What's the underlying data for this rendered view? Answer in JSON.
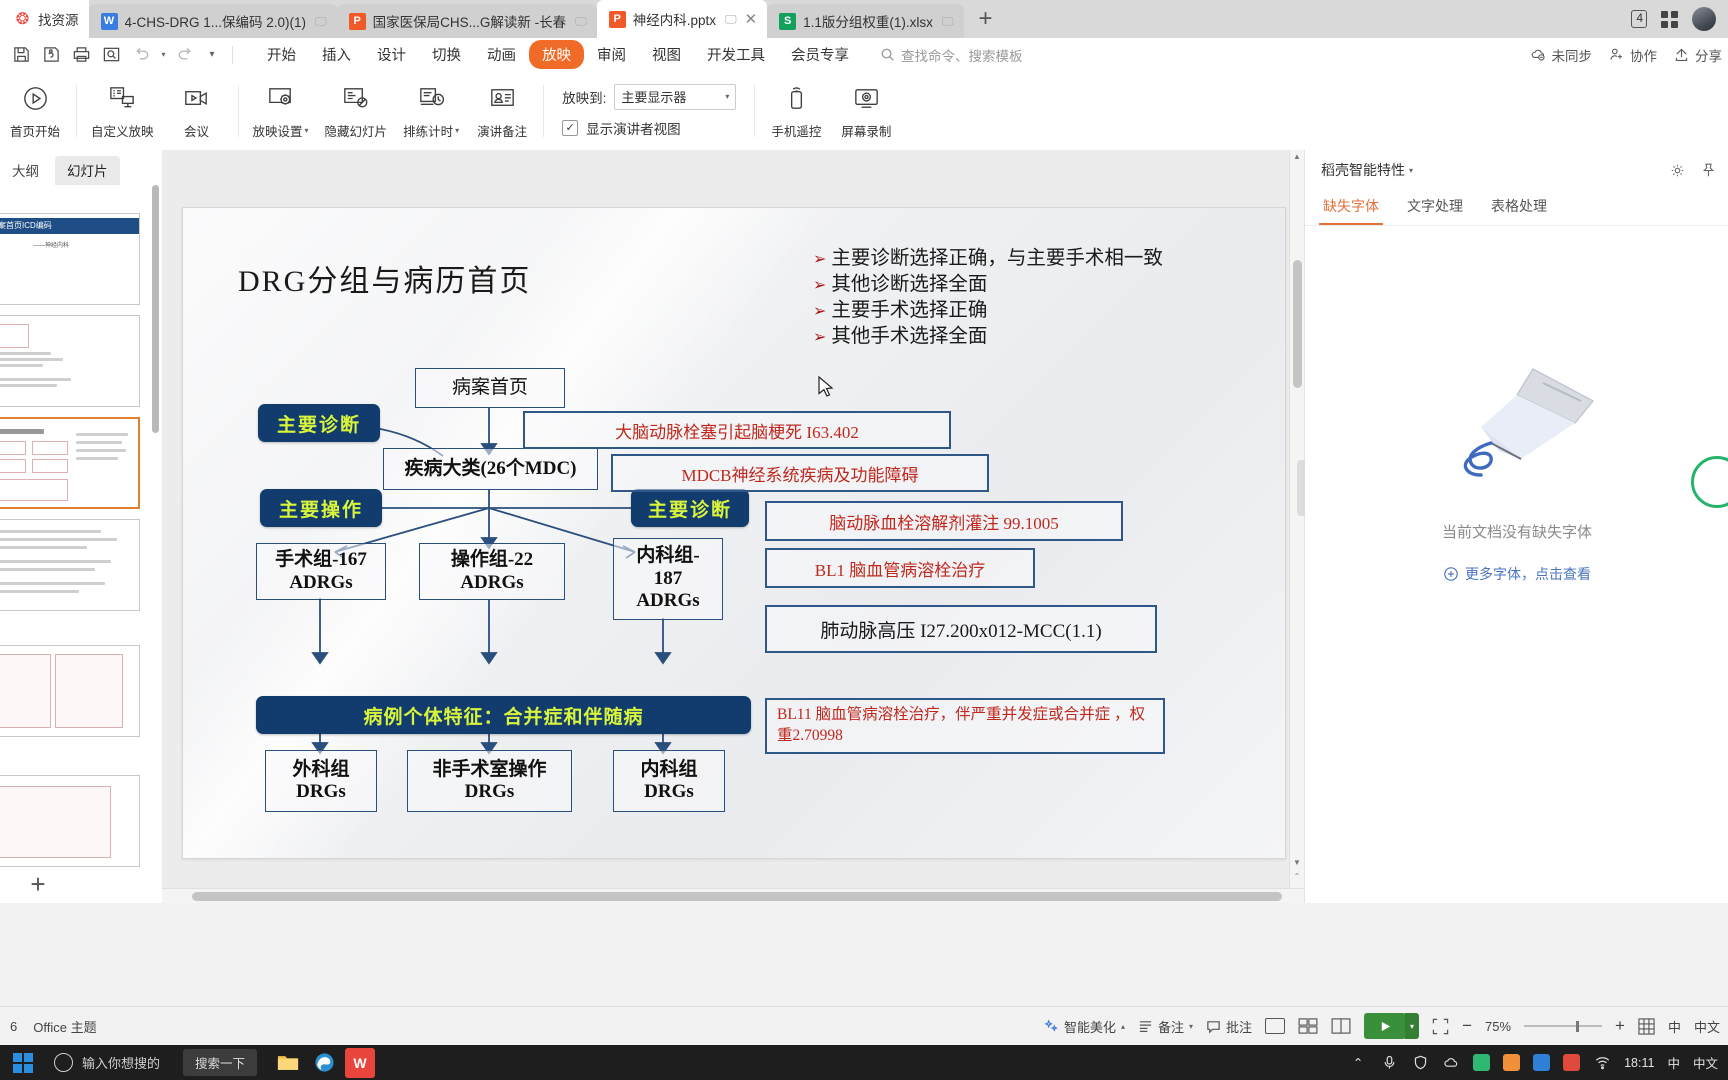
{
  "tabbar": {
    "tabs": [
      {
        "label": "找资源",
        "icon": "wps-resource-icon",
        "kind": "res",
        "monitor": false,
        "closable": false,
        "active": true
      },
      {
        "label": "4-CHS-DRG 1...保编码 2.0)(1)",
        "icon": "writer-doc-icon",
        "kind": "w",
        "monitor": true,
        "closable": false,
        "active": false
      },
      {
        "label": "国家医保局CHS...G解读新 -长春",
        "icon": "presentation-icon",
        "kind": "p",
        "monitor": true,
        "closable": false,
        "active": false
      },
      {
        "label": "神经内科.pptx",
        "icon": "presentation-icon",
        "kind": "p",
        "monitor": true,
        "closable": true,
        "active": true
      },
      {
        "label": "1.1版分组权重(1).xlsx",
        "icon": "spreadsheet-icon",
        "kind": "s",
        "monitor": true,
        "closable": false,
        "active": false
      }
    ],
    "new_tab_label": "+",
    "window_count_badge": "4",
    "app_grid_label": "",
    "avatar_label": ""
  },
  "menubar": {
    "quick_access": [
      "save-icon",
      "save-as-icon",
      "print-icon",
      "print-preview-icon",
      "undo-icon",
      "redo-icon",
      "customize-qat-icon"
    ],
    "menus": [
      {
        "label": "开始",
        "active": false
      },
      {
        "label": "插入",
        "active": false
      },
      {
        "label": "设计",
        "active": false
      },
      {
        "label": "切换",
        "active": false
      },
      {
        "label": "动画",
        "active": false
      },
      {
        "label": "放映",
        "active": true
      },
      {
        "label": "审阅",
        "active": false
      },
      {
        "label": "视图",
        "active": false
      },
      {
        "label": "开发工具",
        "active": false
      },
      {
        "label": "会员专享",
        "active": false
      }
    ],
    "search_placeholder": "查找命令、搜索模板",
    "right_items": [
      {
        "label": "未同步",
        "icon": "cloud-sync-icon"
      },
      {
        "label": "协作",
        "icon": "collaborate-icon"
      },
      {
        "label": "分享",
        "icon": "share-icon"
      }
    ]
  },
  "ribbon": {
    "items": [
      {
        "label": "首页开始",
        "icon": "play-circle-icon",
        "caret": false
      },
      {
        "label": "自定义放映",
        "icon": "custom-show-icon",
        "caret": false
      },
      {
        "label": "会议",
        "icon": "meeting-icon",
        "caret": false
      },
      {
        "label": "放映设置",
        "icon": "show-settings-icon",
        "caret": true
      },
      {
        "label": "隐藏幻灯片",
        "icon": "hide-slide-icon",
        "caret": false
      },
      {
        "label": "排练计时",
        "icon": "rehearse-timing-icon",
        "caret": true
      },
      {
        "label": "演讲备注",
        "icon": "speaker-notes-icon",
        "caret": false
      }
    ],
    "display_field_label": "放映到:",
    "display_value": "主要显示器",
    "presenter_view_label": "显示演讲者视图",
    "presenter_view_checked": true,
    "right_items": [
      {
        "label": "手机遥控",
        "icon": "phone-remote-icon"
      },
      {
        "label": "屏幕录制",
        "icon": "screen-record-icon"
      }
    ]
  },
  "view_tabs": [
    {
      "label": "大纲",
      "active": false
    },
    {
      "label": "幻灯片",
      "active": true
    }
  ],
  "slide_panel": {
    "add_slide_label": "+",
    "thumbnails": [
      {
        "index": 1,
        "selected": false,
        "title": "病案首页ICD编码",
        "subtitle": "——神经内科"
      },
      {
        "index": 2,
        "selected": false,
        "title": "",
        "subtitle": ""
      },
      {
        "index": 3,
        "selected": true,
        "title": "",
        "subtitle": ""
      },
      {
        "index": 4,
        "selected": false,
        "title": "",
        "subtitle": ""
      },
      {
        "index": 5,
        "selected": false,
        "title": "",
        "subtitle": ""
      },
      {
        "index": 6,
        "selected": false,
        "title": "",
        "subtitle": ""
      }
    ]
  },
  "slide": {
    "title": "DRG分组与病历首页",
    "bullets": [
      "主要诊断选择正确，与主要手术相一致",
      "其他诊断选择全面",
      "主要手术选择正确",
      "其他手术选择全面"
    ],
    "bullet_marker": "➢",
    "boxes": {
      "medical_record": "病案首页",
      "mdc": "疾病大类(26个MDC)",
      "proc_group": "操作组-22\nADRGs",
      "surg_group": "手术组-167\nADRGs",
      "med_group": "内科组-\n187\nADRGs",
      "surg_drg": "外科组\nDRGs",
      "nonsurg_drg": "非手术室操作\nDRGs",
      "med_drg": "内科组\nDRGs"
    },
    "navy_labels": {
      "primary_diagnosis_left": "主要诊断",
      "primary_procedure": "主要操作",
      "primary_diagnosis_right": "主要诊断",
      "case_features": "病例个体特征：合并症和伴随病"
    },
    "red_boxes": [
      {
        "text": "大脑动脉栓塞引起脑梗死 I63.402",
        "color": "red"
      },
      {
        "text": "MDCB神经系统疾病及功能障碍",
        "color": "red"
      },
      {
        "text": "脑动脉血栓溶解剂灌注 99.1005",
        "color": "red"
      },
      {
        "text": "BL1 脑血管病溶栓治疗",
        "color": "red"
      },
      {
        "text": "肺动脉高压 I27.200x012-MCC(1.1)",
        "color": "black"
      },
      {
        "text": "BL11 脑血管病溶栓治疗，伴严重并发症或合并症 ，权重2.70998",
        "color": "red"
      }
    ]
  },
  "right_panel": {
    "title": "稻壳智能特性",
    "header_icons": [
      "gear-icon",
      "pin-icon"
    ],
    "tabs": [
      {
        "label": "缺失字体",
        "active": true
      },
      {
        "label": "文字处理",
        "active": false
      },
      {
        "label": "表格处理",
        "active": false
      }
    ],
    "empty_message": "当前文档没有缺失字体",
    "link_label": "更多字体，点击查看"
  },
  "status_bar": {
    "slide_indicator": "6",
    "theme": "Office 主题",
    "right_items": [
      {
        "label": "智能美化",
        "icon": "beautify-icon",
        "caret": true
      },
      {
        "label": "备注",
        "icon": "notes-icon",
        "caret": true
      },
      {
        "label": "批注",
        "icon": "comment-icon",
        "caret": false
      }
    ],
    "view_buttons": [
      "normal-view-icon",
      "slide-sorter-icon",
      "reading-view-icon"
    ],
    "play_label": "",
    "fit_label": "",
    "zoom_level": "75%",
    "zoom_out": "−",
    "zoom_in": "+",
    "ime_labels": [
      "中",
      "中文"
    ]
  },
  "taskbar": {
    "search_placeholder": "输入你想搜的",
    "search_pill": "搜索一下",
    "apps": [
      {
        "name": "file-explorer-icon",
        "color": "#f5bf4f"
      },
      {
        "name": "edge-browser-icon",
        "color": "#2a8fd0"
      },
      {
        "name": "wps-office-icon",
        "color": "#e8453c"
      }
    ],
    "tray": [
      {
        "name": "chevron-up-icon"
      },
      {
        "name": "microphone-icon"
      },
      {
        "name": "shield-icon"
      },
      {
        "name": "cloud-icon"
      },
      {
        "name": "app-green-icon"
      },
      {
        "name": "app-orange-icon"
      },
      {
        "name": "app-blue-icon"
      },
      {
        "name": "app-red-icon"
      },
      {
        "name": "network-icon"
      }
    ],
    "time": "18:11",
    "ime_a": "中",
    "ime_b": "中文"
  }
}
